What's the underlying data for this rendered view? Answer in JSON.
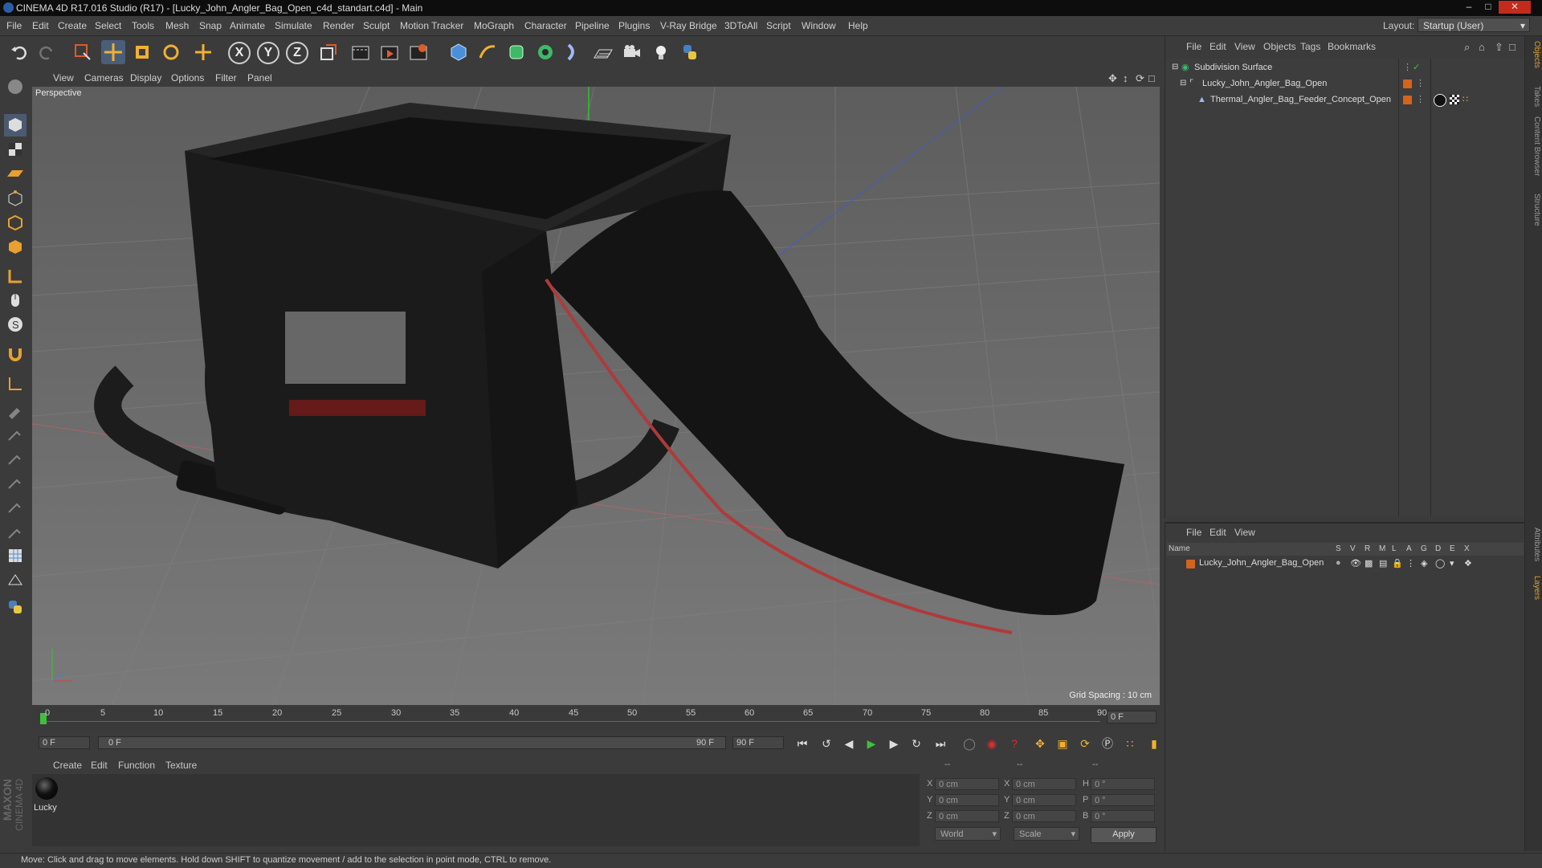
{
  "title_bar": {
    "text": "CINEMA 4D R17.016 Studio (R17) - [Lucky_John_Angler_Bag_Open_c4d_standart.c4d] - Main"
  },
  "menu": [
    "File",
    "Edit",
    "Create",
    "Select",
    "Tools",
    "Mesh",
    "Snap",
    "Animate",
    "Simulate",
    "Render",
    "Sculpt",
    "Motion Tracker",
    "MoGraph",
    "Character",
    "Pipeline",
    "Plugins",
    "V-Ray Bridge",
    "3DToAll",
    "Script",
    "Window",
    "Help"
  ],
  "layout": {
    "label": "Layout:",
    "value": "Startup (User)"
  },
  "toolbar_axes": [
    "X",
    "Y",
    "Z"
  ],
  "viewport": {
    "menu": [
      "View",
      "Cameras",
      "Display",
      "Options",
      "Filter",
      "Panel"
    ],
    "camera_label": "Perspective",
    "grid_spacing": "Grid Spacing : 10 cm"
  },
  "timeline": {
    "ticks": [
      "0",
      "5",
      "10",
      "15",
      "20",
      "25",
      "30",
      "35",
      "40",
      "45",
      "50",
      "55",
      "60",
      "65",
      "70",
      "75",
      "80",
      "85",
      "90"
    ],
    "current_frame": "0 F",
    "start_field": "0 F",
    "range_start": "0 F",
    "range_end": "90 F",
    "end_field": "90 F"
  },
  "material_manager": {
    "menu": [
      "Create",
      "Edit",
      "Function",
      "Texture"
    ],
    "materials": [
      {
        "name": "Lucky"
      }
    ]
  },
  "brand": {
    "line1": "MAXON",
    "line2": "CINEMA 4D"
  },
  "coordinates": {
    "headers": [
      "--",
      "--",
      "--"
    ],
    "rows": [
      {
        "a": "X",
        "av": "0 cm",
        "b": "X",
        "bv": "0 cm",
        "c": "H",
        "cv": "0 °"
      },
      {
        "a": "Y",
        "av": "0 cm",
        "b": "Y",
        "bv": "0 cm",
        "c": "P",
        "cv": "0 °"
      },
      {
        "a": "Z",
        "av": "0 cm",
        "b": "Z",
        "bv": "0 cm",
        "c": "B",
        "cv": "0 °"
      }
    ],
    "space": "World",
    "mode": "Scale",
    "apply": "Apply"
  },
  "object_manager": {
    "menu": [
      "File",
      "Edit",
      "View",
      "Objects",
      "Tags",
      "Bookmarks"
    ],
    "objects": [
      {
        "name": "Subdivision Surface"
      },
      {
        "name": "Lucky_John_Angler_Bag_Open"
      },
      {
        "name": "Thermal_Angler_Bag_Feeder_Concept_Open"
      }
    ]
  },
  "layer_manager": {
    "menu": [
      "File",
      "Edit",
      "View"
    ],
    "columns": [
      "Name",
      "S",
      "V",
      "R",
      "M",
      "L",
      "A",
      "G",
      "D",
      "E",
      "X"
    ],
    "layers": [
      {
        "name": "Lucky_John_Angler_Bag_Open",
        "color": "#d4631e"
      }
    ]
  },
  "side_tabs": [
    "Objects",
    "Takes",
    "Content Browser",
    "Structure",
    "Attributes",
    "Layers"
  ],
  "status": "Move: Click and drag to move elements. Hold down SHIFT to quantize movement / add to the selection in point mode, CTRL to remove.",
  "colors": {
    "accent": "#3a7bd5",
    "object_orange": "#d4631e",
    "viewport_bg": "#6e6e6e"
  }
}
